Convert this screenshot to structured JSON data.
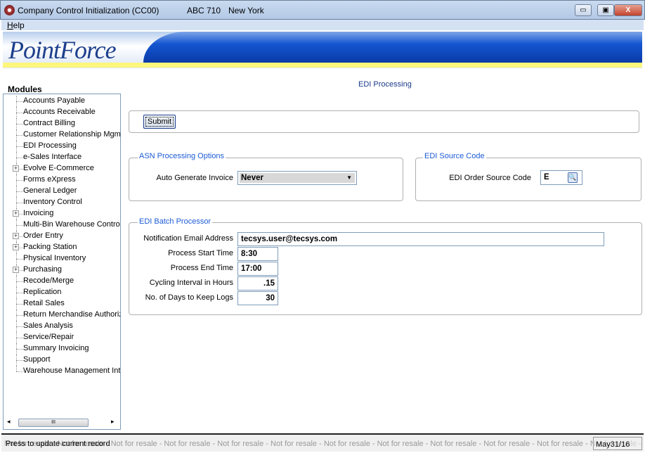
{
  "window": {
    "title": "Company Control Initialization (CC00)",
    "company": "ABC 710",
    "location": "New York",
    "minimize": "▭",
    "restore": "▣",
    "close": "X"
  },
  "menu": {
    "help": "Help"
  },
  "brand": {
    "logo": "PointForce"
  },
  "sidebar": {
    "title": "Modules",
    "items": [
      {
        "label": "Accounts Payable",
        "expandable": false
      },
      {
        "label": "Accounts Receivable",
        "expandable": false
      },
      {
        "label": "Contract Billing",
        "expandable": false
      },
      {
        "label": "Customer Relationship Mgmt",
        "expandable": false
      },
      {
        "label": "EDI Processing",
        "expandable": false
      },
      {
        "label": "e-Sales Interface",
        "expandable": false
      },
      {
        "label": "Evolve E-Commerce",
        "expandable": true
      },
      {
        "label": "Forms eXpress",
        "expandable": false
      },
      {
        "label": "General Ledger",
        "expandable": false
      },
      {
        "label": "Inventory Control",
        "expandable": false
      },
      {
        "label": "Invoicing",
        "expandable": true
      },
      {
        "label": "Multi-Bin Warehouse Control",
        "expandable": false
      },
      {
        "label": "Order Entry",
        "expandable": true
      },
      {
        "label": "Packing Station",
        "expandable": true
      },
      {
        "label": "Physical Inventory",
        "expandable": false
      },
      {
        "label": "Purchasing",
        "expandable": true
      },
      {
        "label": "Recode/Merge",
        "expandable": false
      },
      {
        "label": "Replication",
        "expandable": false
      },
      {
        "label": "Retail Sales",
        "expandable": false
      },
      {
        "label": "Return Merchandise Authoriz",
        "expandable": false
      },
      {
        "label": "Sales Analysis",
        "expandable": false
      },
      {
        "label": "Service/Repair",
        "expandable": false
      },
      {
        "label": "Summary Invoicing",
        "expandable": false
      },
      {
        "label": "Support",
        "expandable": false
      },
      {
        "label": "Warehouse Management Int",
        "expandable": false
      }
    ],
    "scroll_thumb": "III"
  },
  "main": {
    "title": "EDI Processing",
    "submit": "Submit",
    "asn": {
      "legend": "ASN Processing Options",
      "auto_invoice_label": "Auto Generate Invoice",
      "auto_invoice_value": "Never"
    },
    "source": {
      "legend": "EDI Source Code",
      "label": "EDI Order Source Code",
      "value": "E"
    },
    "batch": {
      "legend": "EDI Batch Processor",
      "fields": [
        {
          "label": "Notification Email Address",
          "value": "tecsys.user@tecsys.com"
        },
        {
          "label": "Process Start Time",
          "value": "8:30"
        },
        {
          "label": "Process End Time",
          "value": "17:00"
        },
        {
          "label": "Cycling Interval in Hours",
          "value": ".15"
        },
        {
          "label": "No. of Days to Keep Logs",
          "value": "30"
        }
      ]
    }
  },
  "status": {
    "message": "Press to update current record",
    "watermark": "Not for resale - Not for resale - Not for resale - Not for resale - Not for resale - Not for resale - Not for resale - Not for resale - Not for resale - Not for resale - Not for resale - Not for resale - Not for resale - Not for resale",
    "date": "May31/16"
  }
}
